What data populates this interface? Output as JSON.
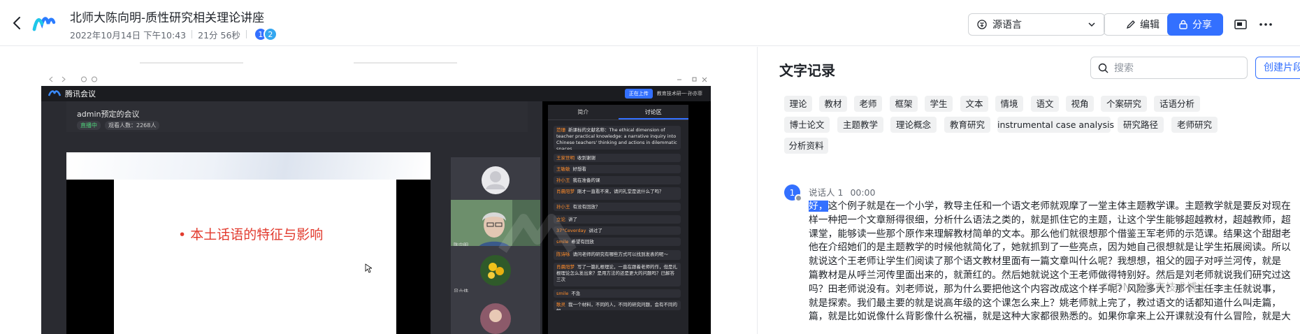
{
  "header": {
    "title": "北师大陈向明-质性研究相关理论讲座",
    "date": "2022年10月14日 下午10:43",
    "duration": "21分 56秒",
    "participants": [
      "1",
      "2"
    ],
    "source_language": "源语言",
    "edit_label": "编辑",
    "share_label": "分享",
    "accent": "#3370ff"
  },
  "video": {
    "app_name": "腾讯会议",
    "upload_label": "正在上传",
    "user_label": "教育技术研一·孙亦菲",
    "meeting_title": "admin预定的会议",
    "status": "直播中",
    "viewers": "观看人数：2268人",
    "slide_text": "• 本土话语的特征与影响",
    "thumb_names": [
      "admin",
      "陈向明",
      "吕六伟",
      ""
    ],
    "chat_tabs": [
      "简介",
      "讨论区"
    ],
    "chat_messages": [
      {
        "name": "范珊",
        "text": "新课标的文献名称：The ethical dimension of teacher practical knowledge: a narrative inquiry into Chinese teachers' thinking and actions in dilemmatic spaces"
      },
      {
        "name": "王家世明",
        "text": "收到谢谢"
      },
      {
        "name": "王敏敏",
        "text": "好想看"
      },
      {
        "name": "孙小王",
        "text": "我在准备的课"
      },
      {
        "name": "肖晨阳梦",
        "text": "刚才一直看不来，请问礼堂是说什么了吗？"
      },
      {
        "name": "孙小王",
        "text": "有没有回放？"
      },
      {
        "name": "立论",
        "text": "讲了"
      },
      {
        "name": "37°Ceverday",
        "text": "讲过了"
      },
      {
        "name": "smile",
        "text": "希望有回放"
      },
      {
        "name": "陈诗咏",
        "text": "请问老师的研究有哪些方式可以找到发表的呢～"
      },
      {
        "name": "肖晨阳梦",
        "text": "写了一篇扎根理论，一直在跟着老师的作，但是扎根理论怎么发出来？是用方法的还是更大的问题吗？已解答三次"
      },
      {
        "name": "smile",
        "text": "不急"
      },
      {
        "name": "歌灵",
        "text": "我一个材料，不同的人，不同的研究问题，会有不同的解"
      }
    ]
  },
  "transcript_panel": {
    "title": "文字记录",
    "search_placeholder": "搜索",
    "create_label": "创建片段",
    "keywords": [
      "理论",
      "教材",
      "老师",
      "框架",
      "学生",
      "文本",
      "情境",
      "语文",
      "视角",
      "个案研究",
      "话语分析",
      "博士论文",
      "主题教学",
      "理论概念",
      "教育研究",
      "instrumental case analysis",
      "研究路径",
      "老师研究",
      "分析资料"
    ],
    "speaker": {
      "avatar": "1",
      "name": "说话人 1",
      "time": "00:00"
    },
    "highlight": "好，",
    "text_lines": [
      "这个例子就是在一个小学，教导主任和一个语文老师就观摩了一堂主体主题教学课。主题教学就是要反对现在",
      "样一种把一个文章掰得很细，分析什么语法之类的，就是抓住它的主题，让这个学生能够超越教材，超越教师，超",
      "课堂，能够读一些那个原作来理解教材简单的文本。那么他们就很想那个借鉴王军老师的示范课。结果这个甜甜老",
      "他在介绍她们的是主题教学的时候他就简化了，她就抓到了一些亮点，因为她自己很想就是让学生拓展阅读。所以",
      "就说这个王老师让学生们阅读了那个语文教材里面有一篇文章叫什么呢？我想想，祖父的园子对呼兰河传，就是",
      "篇教材是从呼兰河传里面出来的，就萧红的。然后她就说这个王老师做得特别好。然后是刘老师就说我们研究过这",
      "吗？田老师说没有。刘老师说，那为什么要把他这个内容改成这个样子呢？风险多大？那个主任李主任就说事，",
      "就是探索。我们最主要的就是说高年级的这个课怎么来上？姚老师就上完了，教过语文的话都知道什么叫走篇，",
      "篇，就是比如说像什么背影像什么祝福，就是这种大家都很熟悉的。如果你拿来上公开课就没有什么冒险，就是大"
    ]
  },
  "watermark": "CSDN @教育技术博士"
}
